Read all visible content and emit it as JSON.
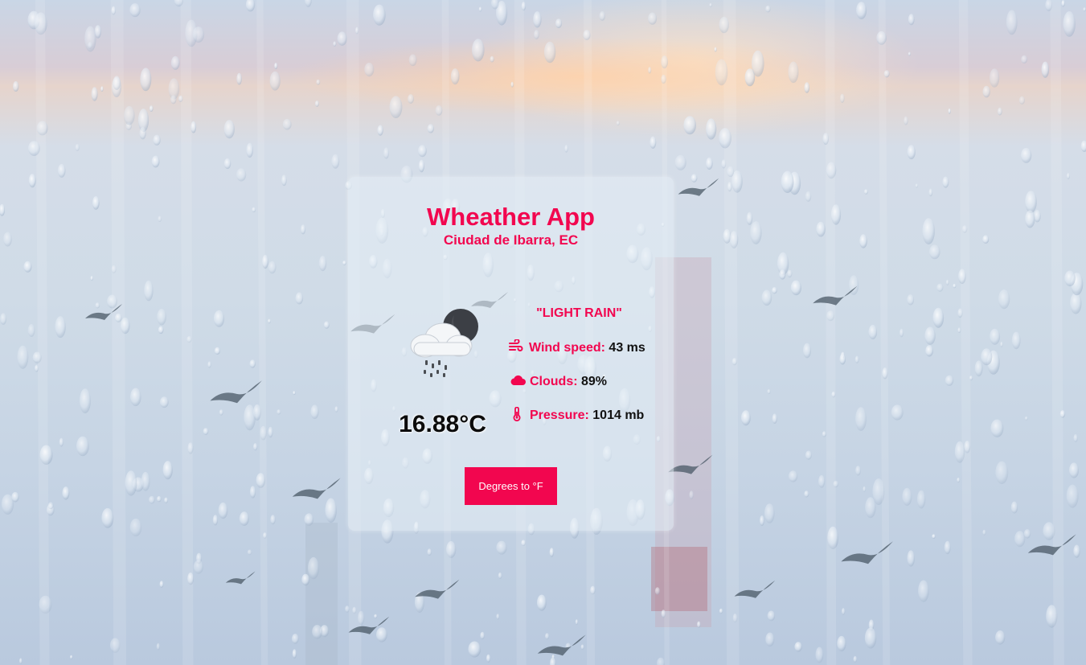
{
  "app": {
    "title": "Wheather App",
    "location": "Ciudad de Ibarra, EC"
  },
  "weather": {
    "icon": "cloud-rain-night-icon",
    "description": "\"LIGHT RAIN\"",
    "temperature": "16.88°C",
    "wind": {
      "label": "Wind speed:",
      "value": "43 ms",
      "icon": "wind-icon"
    },
    "clouds": {
      "label": "Clouds:",
      "value": "89%",
      "icon": "cloud-icon"
    },
    "pressure": {
      "label": "Pressure:",
      "value": "1014 mb",
      "icon": "thermometer-icon"
    }
  },
  "actions": {
    "toggle_units_label": "Degrees to °F"
  },
  "colors": {
    "accent": "#f2064f",
    "text": "#111111",
    "card": "#e6eef6"
  }
}
